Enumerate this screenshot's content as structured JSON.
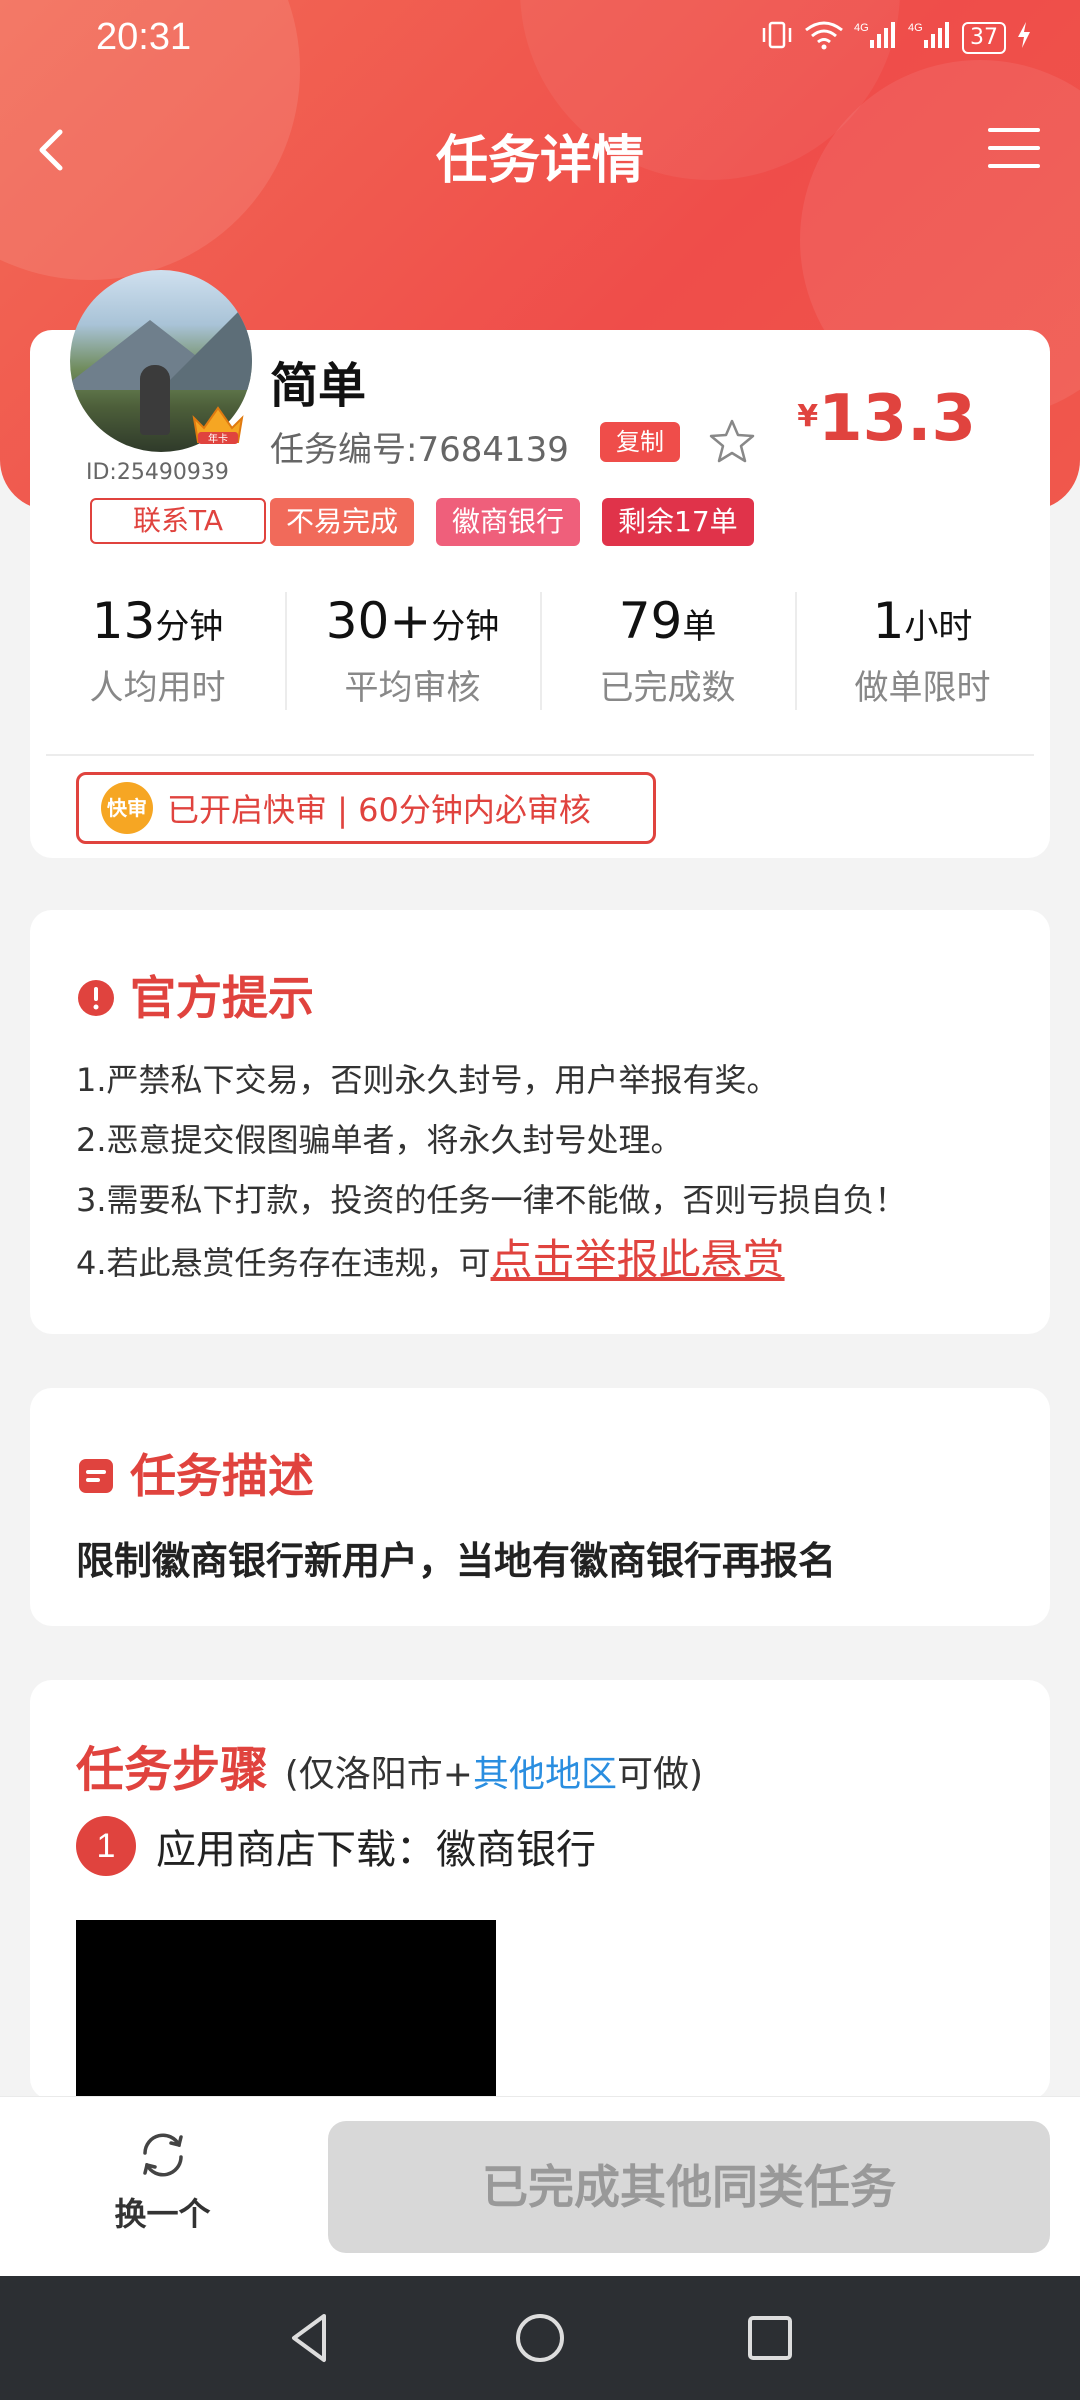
{
  "status_bar": {
    "time": "20:31",
    "battery": "37",
    "network": "4G"
  },
  "nav": {
    "title": "任务详情"
  },
  "task": {
    "name": "简单",
    "number_label": "任务编号:7684139",
    "copy_label": "复制",
    "price_symbol": "¥",
    "price": "13.3",
    "user_id": "ID:25490939",
    "badge": "年卡",
    "contact_label": "联系TA",
    "tags": [
      "不易完成",
      "徽商银行",
      "剩余17单"
    ]
  },
  "stats": [
    {
      "value": "13",
      "unit": "分钟",
      "label": "人均用时"
    },
    {
      "value": "30+",
      "unit": "分钟",
      "label": "平均审核"
    },
    {
      "value": "79",
      "unit": "单",
      "label": "已完成数"
    },
    {
      "value": "1",
      "unit": "小时",
      "label": "做单限时"
    }
  ],
  "fast_review": {
    "icon_text": "快审",
    "text": "已开启快审 | 60分钟内必审核"
  },
  "notice": {
    "title": "官方提示",
    "items": [
      "1.严禁私下交易，否则永久封号，用户举报有奖。",
      "2.恶意提交假图骗单者，将永久封号处理。",
      "3.需要私下打款，投资的任务一律不能做，否则亏损自负！",
      "4.若此悬赏任务存在违规，可"
    ],
    "report_link": "点击举报此悬赏"
  },
  "description": {
    "title": "任务描述",
    "text": "限制徽商银行新用户，当地有徽商银行再报名"
  },
  "steps": {
    "title": "任务步骤",
    "scope_prefix": "(仅洛阳市+",
    "scope_link": "其他地区",
    "scope_suffix": "可做)",
    "items": [
      {
        "num": "1",
        "text": "应用商店下载：徽商银行"
      }
    ]
  },
  "action_bar": {
    "swap_label": "换一个",
    "complete_label": "已完成其他同类任务"
  },
  "colors": {
    "primary": "#e0433e",
    "header": "#ef4d4a",
    "link_blue": "#2a8ee0"
  }
}
